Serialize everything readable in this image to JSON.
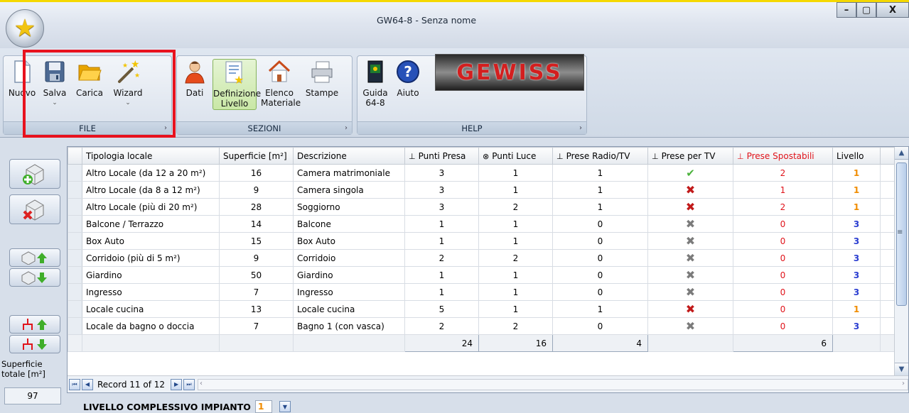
{
  "window": {
    "title": "GW64-8 - Senza nome",
    "controls": [
      "–",
      "▢",
      "X"
    ]
  },
  "ribbon": {
    "groups": [
      {
        "label": "FILE",
        "buttons": [
          {
            "label": "Nuovo",
            "icon": "new-document-icon"
          },
          {
            "label": "Salva",
            "icon": "save-disk-icon",
            "has_dropdown": true
          },
          {
            "label": "Carica",
            "icon": "open-folder-icon"
          },
          {
            "label": "Wizard",
            "icon": "magic-wand-icon",
            "has_dropdown": true
          }
        ]
      },
      {
        "label": "SEZIONI",
        "buttons": [
          {
            "label": "Dati",
            "icon": "user-icon"
          },
          {
            "label": "Definizione Livello",
            "icon": "level-definition-icon",
            "active": true
          },
          {
            "label": "Elenco Materiale",
            "icon": "house-icon"
          },
          {
            "label": "Stampe",
            "icon": "printer-icon"
          }
        ]
      },
      {
        "label": "HELP",
        "buttons": [
          {
            "label": "Guida 64-8",
            "icon": "book-icon"
          },
          {
            "label": "Aiuto",
            "icon": "help-icon"
          }
        ]
      }
    ],
    "logo_text": "GEWISS"
  },
  "sidebar": {
    "superficie_label": "Superficie totale [m²]",
    "superficie_value": "97"
  },
  "grid": {
    "columns": [
      "Tipologia locale",
      "Superficie [m²]",
      "Descrizione",
      "Punti Presa",
      "Punti Luce",
      "Prese Radio/TV",
      "Prese per TV",
      "Prese Spostabili",
      "Livello"
    ],
    "rows": [
      {
        "tipologia": "Altro Locale (da 12 a 20 m²)",
        "superficie": "16",
        "descrizione": "Camera matrimoniale",
        "punti_presa": "3",
        "punti_luce": "1",
        "prese_radio_tv": "1",
        "prese_tv": "check",
        "prese_spostabili": "2",
        "livello": "1"
      },
      {
        "tipologia": "Altro Locale (da 8 a 12 m²)",
        "superficie": "9",
        "descrizione": "Camera singola",
        "punti_presa": "3",
        "punti_luce": "1",
        "prese_radio_tv": "1",
        "prese_tv": "x-red",
        "prese_spostabili": "1",
        "livello": "1"
      },
      {
        "tipologia": "Altro Locale (più di 20 m²)",
        "superficie": "28",
        "descrizione": "Soggiorno",
        "punti_presa": "3",
        "punti_luce": "2",
        "prese_radio_tv": "1",
        "prese_tv": "x-red",
        "prese_spostabili": "2",
        "livello": "1"
      },
      {
        "tipologia": "Balcone / Terrazzo",
        "superficie": "14",
        "descrizione": "Balcone",
        "punti_presa": "1",
        "punti_luce": "1",
        "prese_radio_tv": "0",
        "prese_tv": "x-gray",
        "prese_spostabili": "0",
        "livello": "3"
      },
      {
        "tipologia": "Box Auto",
        "superficie": "15",
        "descrizione": "Box Auto",
        "punti_presa": "1",
        "punti_luce": "1",
        "prese_radio_tv": "0",
        "prese_tv": "x-gray",
        "prese_spostabili": "0",
        "livello": "3"
      },
      {
        "tipologia": "Corridoio (più di 5 m²)",
        "superficie": "9",
        "descrizione": "Corridoio",
        "punti_presa": "2",
        "punti_luce": "2",
        "prese_radio_tv": "0",
        "prese_tv": "x-gray",
        "prese_spostabili": "0",
        "livello": "3"
      },
      {
        "tipologia": "Giardino",
        "superficie": "50",
        "descrizione": "Giardino",
        "punti_presa": "1",
        "punti_luce": "1",
        "prese_radio_tv": "0",
        "prese_tv": "x-gray",
        "prese_spostabili": "0",
        "livello": "3"
      },
      {
        "tipologia": "Ingresso",
        "superficie": "7",
        "descrizione": "Ingresso",
        "punti_presa": "1",
        "punti_luce": "1",
        "prese_radio_tv": "0",
        "prese_tv": "x-gray",
        "prese_spostabili": "0",
        "livello": "3"
      },
      {
        "tipologia": "Locale cucina",
        "superficie": "13",
        "descrizione": "Locale cucina",
        "punti_presa": "5",
        "punti_luce": "1",
        "prese_radio_tv": "1",
        "prese_tv": "x-red",
        "prese_spostabili": "0",
        "livello": "1"
      },
      {
        "tipologia": "Locale da bagno o doccia",
        "superficie": "7",
        "descrizione": "Bagno 1 (con vasca)",
        "punti_presa": "2",
        "punti_luce": "2",
        "prese_radio_tv": "0",
        "prese_tv": "x-gray",
        "prese_spostabili": "0",
        "livello": "3"
      }
    ],
    "totals": {
      "punti_presa": "24",
      "punti_luce": "16",
      "prese_radio_tv": "4",
      "prese_spostabili": "6"
    },
    "navigator": {
      "record_label": "Record 11 of 12"
    }
  },
  "footer": {
    "livello_label": "LIVELLO COMPLESSIVO IMPIANTO",
    "livello_value": "1"
  },
  "colors": {
    "accent_red": "#e8121e",
    "level1": "#f08c00",
    "level3": "#2b3ed1",
    "check": "#4bb23c"
  }
}
